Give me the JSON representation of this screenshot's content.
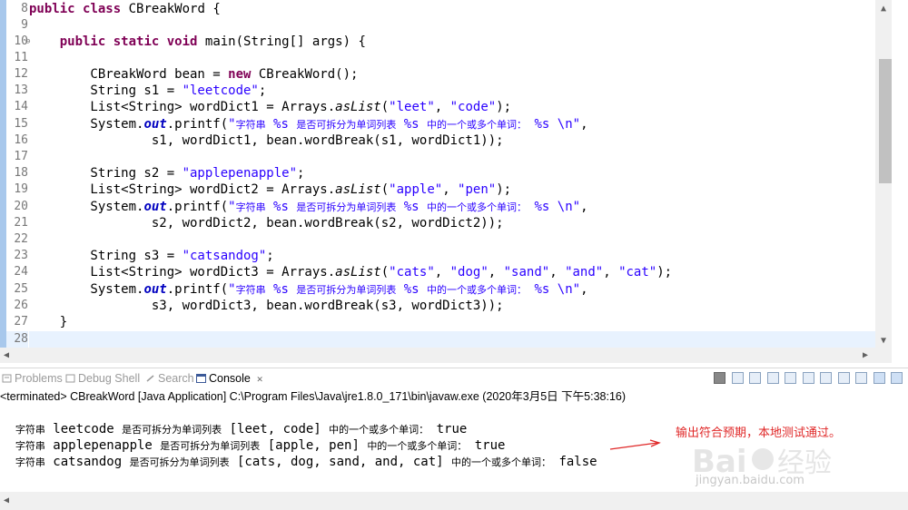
{
  "editor": {
    "line_numbers": [
      "8",
      "9",
      "10",
      "11",
      "12",
      "13",
      "14",
      "15",
      "16",
      "17",
      "18",
      "19",
      "20",
      "21",
      "22",
      "23",
      "24",
      "25",
      "26",
      "27",
      "28"
    ],
    "current_line_index": 20
  },
  "console": {
    "tabs": [
      {
        "label": "Problems",
        "icon": "problems-icon",
        "active": false
      },
      {
        "label": "Debug Shell",
        "icon": "debug-shell-icon",
        "active": false
      },
      {
        "label": "Search",
        "icon": "search-icon",
        "active": false
      },
      {
        "label": "Console",
        "icon": "console-icon",
        "active": true,
        "close": "✕"
      }
    ],
    "status": "<terminated> CBreakWord [Java Application] C:\\Program Files\\Java\\jre1.8.0_171\\bin\\javaw.exe (2020年3月5日 下午5:38:16)",
    "output": [
      {
        "p1": "字符串",
        "word": " leetcode ",
        "p2": "是否可拆分为单词列表",
        "list": " [leet, code] ",
        "p3": "中的一个或多个单词：",
        "res": " true"
      },
      {
        "p1": "字符串",
        "word": " applepenapple ",
        "p2": "是否可拆分为单词列表",
        "list": " [apple, pen] ",
        "p3": "中的一个或多个单词：",
        "res": " true"
      },
      {
        "p1": "字符串",
        "word": " catsandog ",
        "p2": "是否可拆分为单词列表",
        "list": " [cats, dog, sand, and, cat] ",
        "p3": "中的一个或多个单词：",
        "res": " false"
      }
    ]
  },
  "annotation": {
    "text": "输出符合预期，本地测试通过。",
    "color": "#e02828"
  },
  "watermark": {
    "text": "jingyan.baidu.com"
  },
  "colors": {
    "keyword": "#7f0055",
    "string": "#2a00ff",
    "field": "#0000c0",
    "ruler": "#a8c8ec",
    "current_line": "#e8f2fe"
  }
}
